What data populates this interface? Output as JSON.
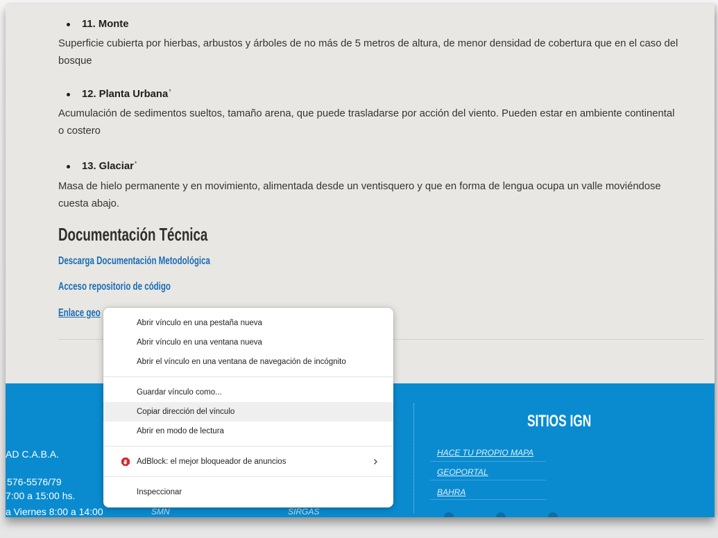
{
  "content": {
    "items": [
      {
        "heading": "11. Monte",
        "lines": [
          "Superficie cubierta por hierbas, arbustos y árboles de no más de 5 metros de altura, de menor densidad de cobertura que en el caso del",
          "bosque"
        ]
      },
      {
        "heading": "12. Planta Urbana",
        "mark": "*",
        "lines": [
          "Acumulación de sedimentos sueltos, tamaño arena, que puede trasladarse por acción del viento. Pueden estar en ambiente continental",
          "o costero"
        ]
      },
      {
        "heading": "13. Glaciar",
        "mark": "*",
        "lines": [
          "Masa de hielo permanente y en movimiento, alimentada desde un ventisquero y que en forma de lengua ocupa un valle moviéndose",
          "cuesta abajo."
        ]
      }
    ],
    "doc_heading": "Documentación Técnica",
    "doc_links": [
      "Descarga Documentación Metodológica",
      "Acceso repositorio de código",
      "Enlace geo"
    ]
  },
  "footer": {
    "left_lines": [
      "AD C.A.B.A.",
      "576-5576/79",
      "7:00 a 15:00 hs.",
      "a Viernes 8:00 a 14:00"
    ],
    "middle_links": [
      "SMN",
      "SIRGAS"
    ],
    "sitios_title": "SITIOS IGN",
    "sitios_links": [
      "HACE TU PROPIO MAPA",
      "GEOPORTAL",
      "BAHRA"
    ]
  },
  "context_menu": {
    "items": [
      {
        "label": "Abrir vínculo en una pestaña nueva",
        "highlighted": false
      },
      {
        "label": "Abrir vínculo en una ventana nueva",
        "highlighted": false
      },
      {
        "label": "Abrir el vínculo en una ventana de navegación de incógnito",
        "highlighted": false
      },
      {
        "label": "Guardar vínculo como...",
        "highlighted": false
      },
      {
        "label": "Copiar dirección del vínculo",
        "highlighted": true
      },
      {
        "label": "Abrir en modo de lectura",
        "highlighted": false
      },
      {
        "label": "AdBlock: el mejor bloqueador de anuncios",
        "highlighted": false,
        "icon": "adblock-icon",
        "submenu": true
      },
      {
        "label": "Inspeccionar",
        "highlighted": false
      }
    ]
  },
  "colors": {
    "page_bg": "#e8e7e3",
    "footer_bg": "#0a8bd0",
    "link": "#1b6db5",
    "menu_highlight": "#efefef",
    "adblock_red": "#d8262b"
  }
}
